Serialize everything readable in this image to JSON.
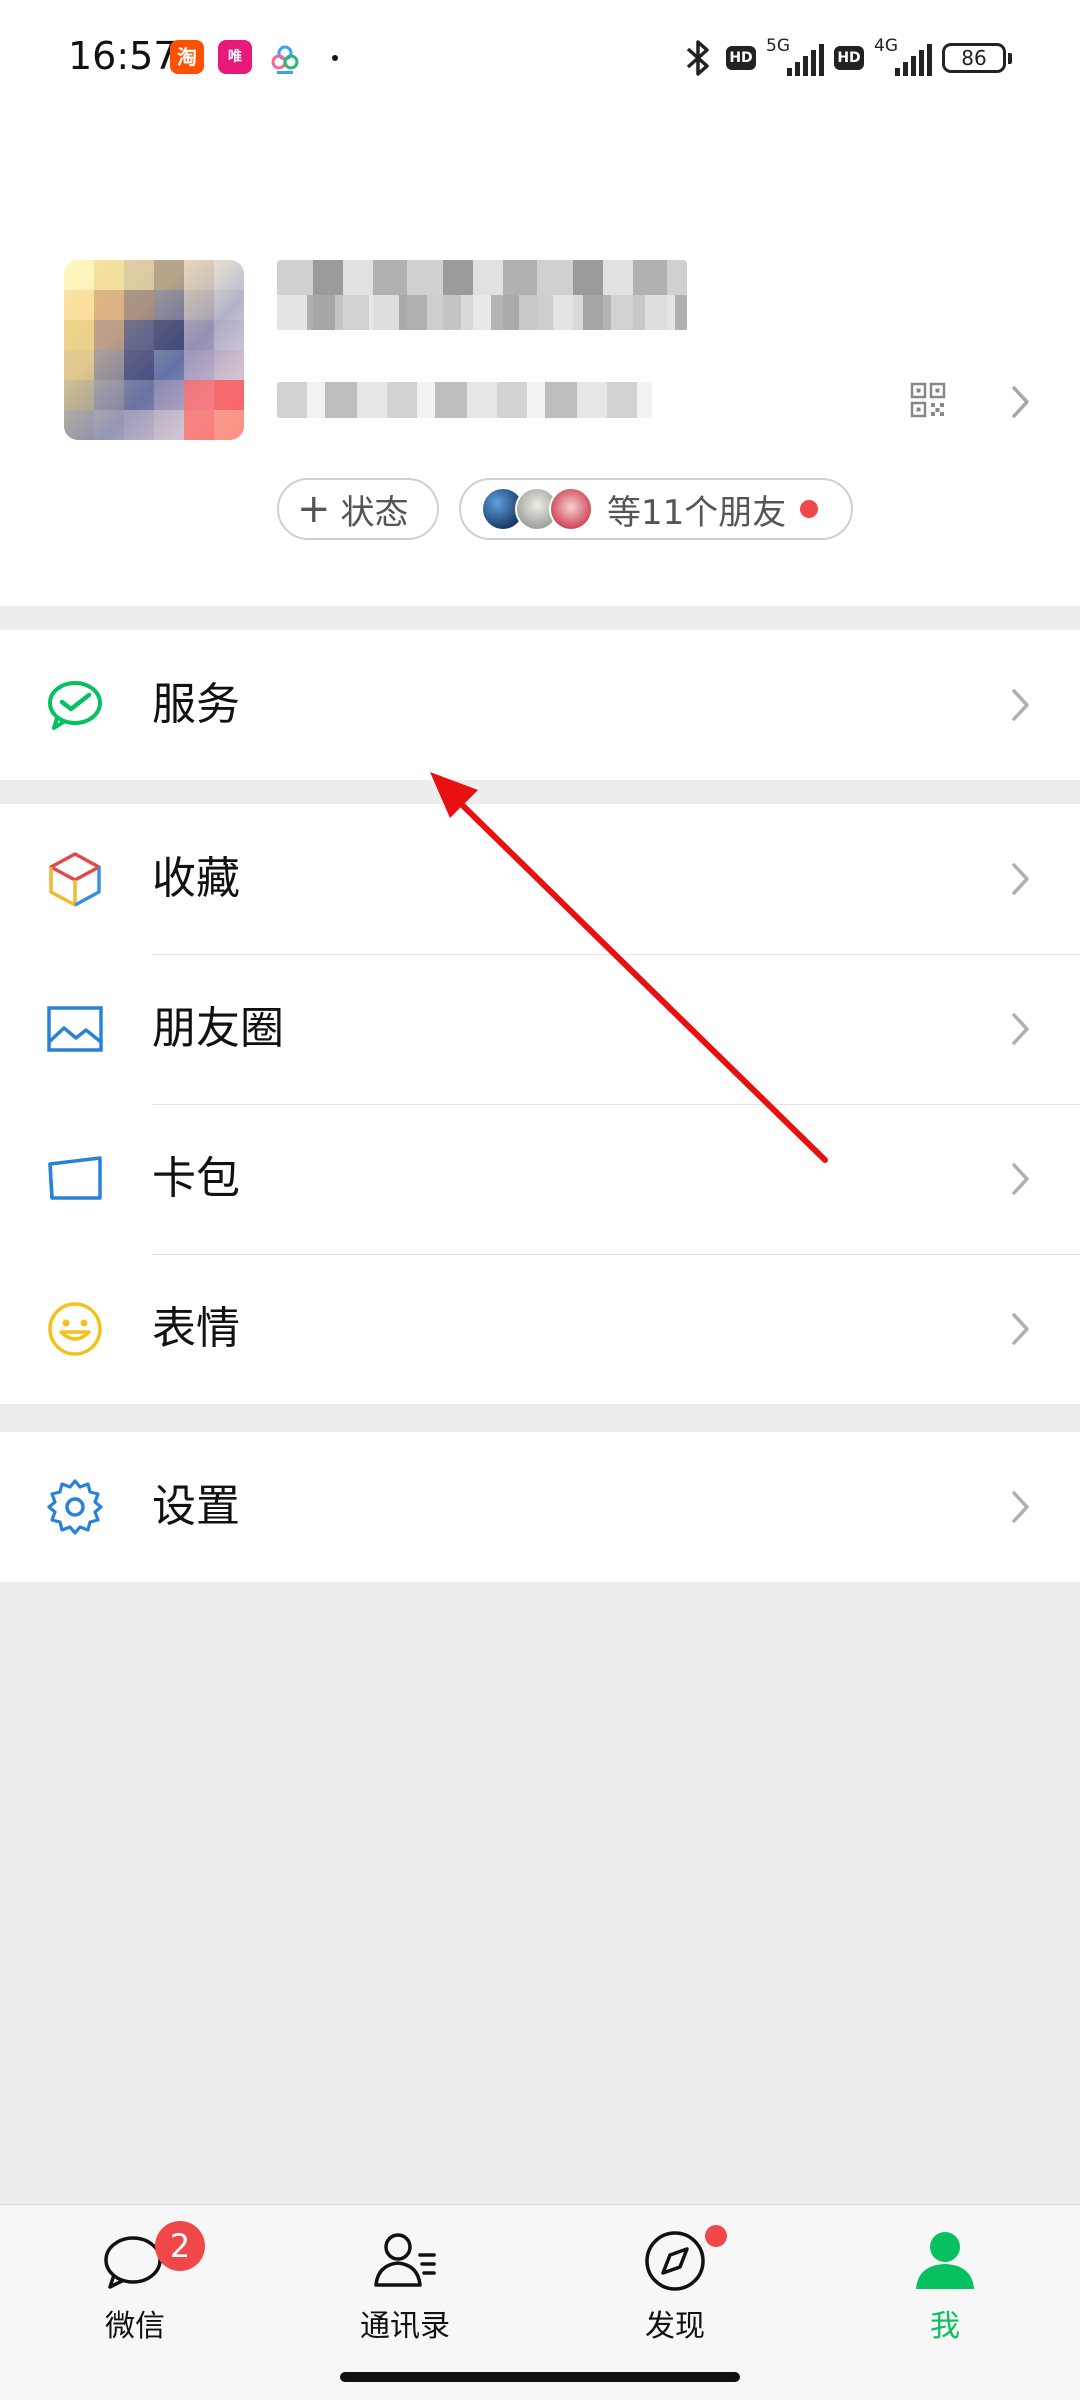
{
  "status_bar": {
    "time": "16:57",
    "apps": [
      {
        "icon": "taobao-icon",
        "glyph": "淘",
        "color": "#ff5000"
      },
      {
        "icon": "vip-icon",
        "glyph": "唯",
        "color": "#e8197a"
      },
      {
        "icon": "cloud-app-icon",
        "glyph": "",
        "color": "#3aa0ff"
      }
    ],
    "network1": "5G",
    "network2": "4G",
    "hd_label": "HD",
    "battery": "86"
  },
  "profile": {
    "status_button": "状态",
    "status_plus": "+",
    "friends_text": "等11个朋友"
  },
  "menu": {
    "groups": [
      [
        {
          "key": "service",
          "label": "服务",
          "icon": "wechat-pay-icon"
        }
      ],
      [
        {
          "key": "favorites",
          "label": "收藏",
          "icon": "favorites-cube-icon"
        },
        {
          "key": "moments",
          "label": "朋友圈",
          "icon": "moments-image-icon"
        },
        {
          "key": "cards",
          "label": "卡包",
          "icon": "card-wallet-icon"
        },
        {
          "key": "stickers",
          "label": "表情",
          "icon": "smiley-icon"
        }
      ],
      [
        {
          "key": "settings",
          "label": "设置",
          "icon": "gear-icon"
        }
      ]
    ]
  },
  "tabbar": {
    "tabs": [
      {
        "key": "chats",
        "label": "微信",
        "icon": "chat-bubble-icon",
        "badge": "2"
      },
      {
        "key": "contacts",
        "label": "通讯录",
        "icon": "contacts-icon"
      },
      {
        "key": "discover",
        "label": "发现",
        "icon": "compass-icon",
        "dot": true
      },
      {
        "key": "me",
        "label": "我",
        "icon": "person-icon",
        "active": true
      }
    ]
  },
  "colors": {
    "accent": "#07c160",
    "badge": "#f04848",
    "annotation_arrow": "#e81010"
  }
}
